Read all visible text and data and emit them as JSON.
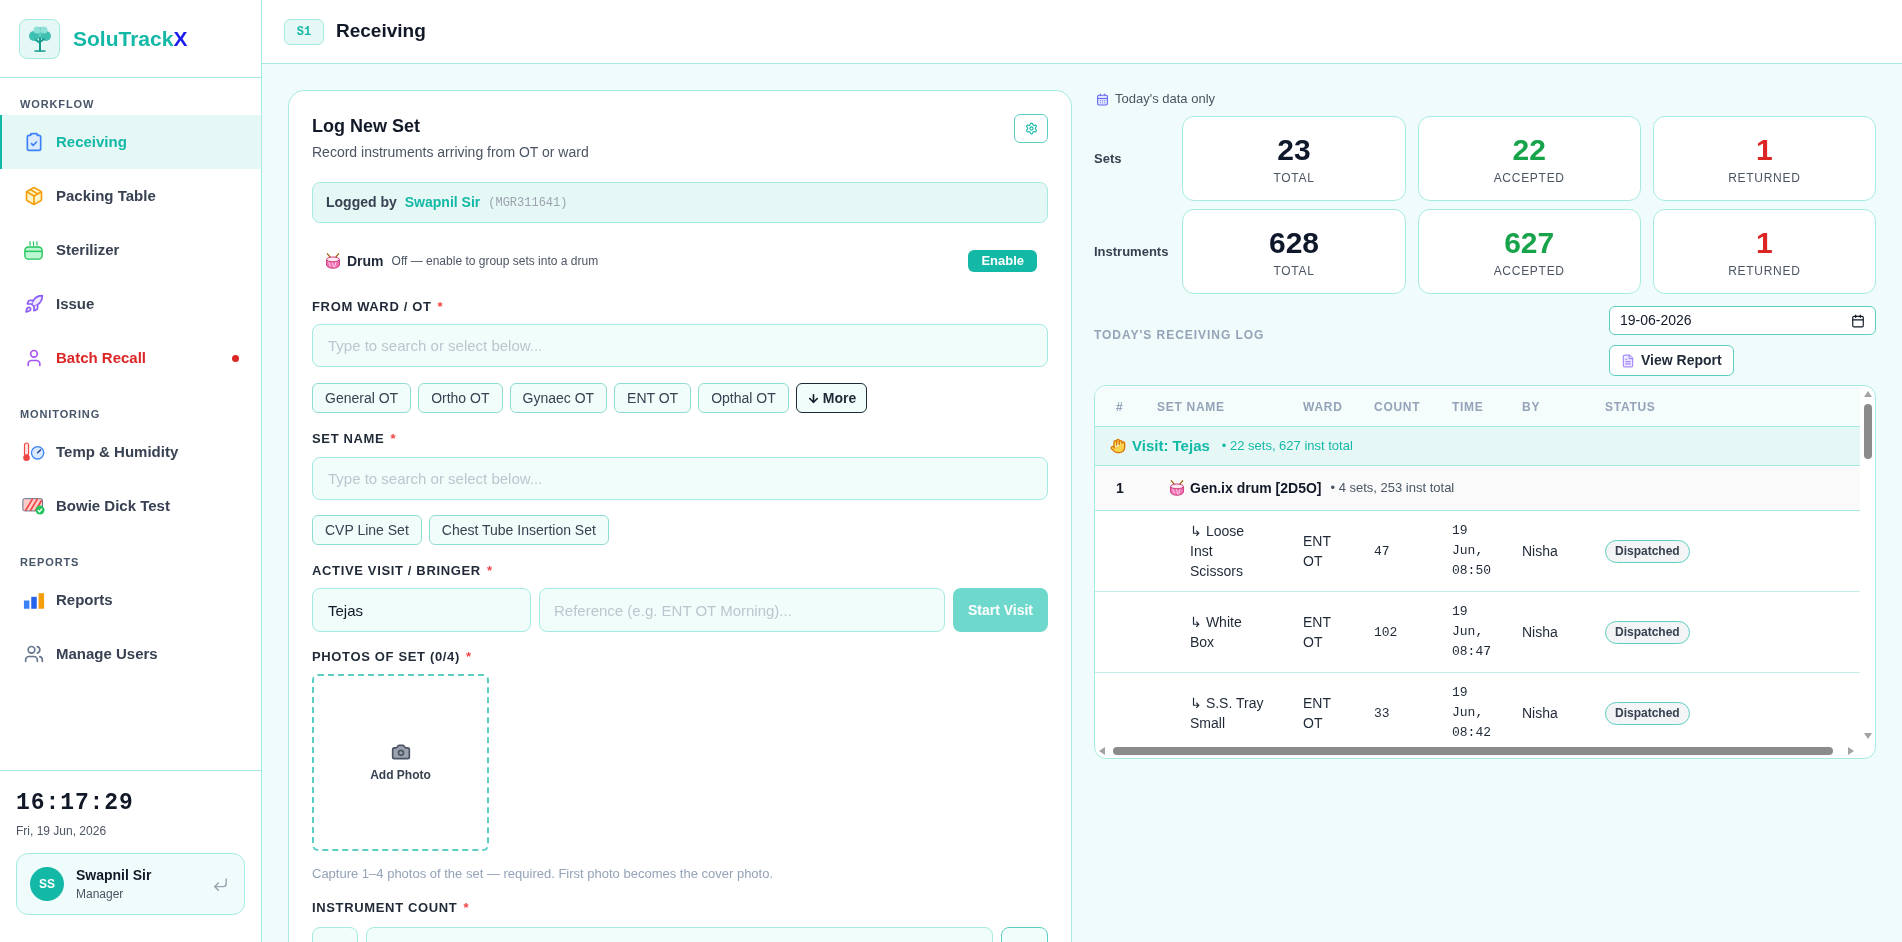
{
  "sidebar": {
    "brand": {
      "name": "SoluTrack",
      "accent": "X"
    },
    "sections": [
      {
        "title": "WORKFLOW",
        "items": [
          {
            "label": "Receiving",
            "selected": true,
            "alert": false
          },
          {
            "label": "Packing Table",
            "selected": false,
            "alert": false
          },
          {
            "label": "Sterilizer",
            "selected": false,
            "alert": false
          },
          {
            "label": "Issue",
            "selected": false,
            "alert": false
          },
          {
            "label": "Batch Recall",
            "selected": false,
            "alert": true
          }
        ]
      },
      {
        "title": "MONITORING",
        "items": [
          {
            "label": "Temp & Humidity",
            "selected": false,
            "alert": false
          },
          {
            "label": "Bowie Dick Test",
            "selected": false,
            "alert": false
          }
        ]
      },
      {
        "title": "REPORTS",
        "items": [
          {
            "label": "Reports",
            "selected": false,
            "alert": false
          },
          {
            "label": "Manage Users",
            "selected": false,
            "alert": false
          }
        ]
      }
    ],
    "clock": {
      "time": "16:17:29",
      "date": "Fri, 19 Jun, 2026"
    },
    "user": {
      "initials": "SS",
      "name": "Swapnil Sir",
      "role": "Manager"
    }
  },
  "header": {
    "badge": "S1",
    "title": "Receiving"
  },
  "form": {
    "title": "Log New Set",
    "subtitle": "Record instruments arriving from OT or ward",
    "logged_by": {
      "label": "Logged by",
      "name": "Swapnil Sir",
      "code": "(MGR311641)"
    },
    "drum": {
      "label": "Drum",
      "description": "Off — enable to group sets into a drum",
      "button": "Enable"
    },
    "ward": {
      "label": "FROM WARD / OT",
      "required_mark": "*",
      "placeholder": "Type to search or select below...",
      "chips": [
        "General OT",
        "Ortho OT",
        "Gynaec OT",
        "ENT OT",
        "Opthal OT"
      ],
      "more": "More"
    },
    "set_name": {
      "label": "SET NAME",
      "required_mark": "*",
      "placeholder": "Type to search or select below...",
      "chips": [
        "CVP Line Set",
        "Chest Tube Insertion Set"
      ]
    },
    "visit": {
      "label": "ACTIVE VISIT / BRINGER",
      "required_mark": "*",
      "bringer": {
        "value": "Tejas"
      },
      "reference": {
        "placeholder": "Reference (e.g. ENT OT Morning)..."
      },
      "button": {
        "label": "Start Visit",
        "disabled": true
      }
    },
    "photos": {
      "label": "PHOTOS OF SET (0/4)",
      "required_mark": "*",
      "add": "Add Photo",
      "hint": "Capture 1–4 photos of the set — required. First photo becomes the cover photo."
    },
    "instrument_count": {
      "label": "INSTRUMENT COUNT",
      "required_mark": "*"
    }
  },
  "summary": {
    "note": "Today's data only",
    "rows": [
      {
        "label": "Sets",
        "cells": [
          {
            "value": "23",
            "label": "TOTAL",
            "kind": "total"
          },
          {
            "value": "22",
            "label": "ACCEPTED",
            "kind": "accepted"
          },
          {
            "value": "1",
            "label": "RETURNED",
            "kind": "returned"
          }
        ]
      },
      {
        "label": "Instruments",
        "cells": [
          {
            "value": "628",
            "label": "TOTAL",
            "kind": "total"
          },
          {
            "value": "627",
            "label": "ACCEPTED",
            "kind": "accepted"
          },
          {
            "value": "1",
            "label": "RETURNED",
            "kind": "returned"
          }
        ]
      }
    ]
  },
  "log": {
    "title": "TODAY'S RECEIVING LOG",
    "date": {
      "value": "19-06-2026"
    },
    "report_button": "View Report",
    "table": {
      "columns": [
        "#",
        "SET NAME",
        "WARD",
        "COUNT",
        "TIME",
        "BY",
        "STATUS"
      ],
      "visit": {
        "label": "Visit: Tejas",
        "summary": "• 22 sets, 627 inst total"
      },
      "group": {
        "index": "1",
        "name": "Gen.ix drum [2D5O]",
        "summary": "• 4 sets, 253 inst total"
      },
      "rows": [
        {
          "name": "↳ Loose Inst Scissors",
          "ward": "ENT OT",
          "count": "47",
          "time": "19 Jun, 08:50",
          "by": "Nisha",
          "status": "Dispatched"
        },
        {
          "name": "↳ White Box",
          "ward": "ENT OT",
          "count": "102",
          "time": "19 Jun, 08:47",
          "by": "Nisha",
          "status": "Dispatched"
        },
        {
          "name": "↳ S.S. Tray Small",
          "ward": "ENT OT",
          "count": "33",
          "time": "19 Jun, 08:42",
          "by": "Nisha",
          "status": "Dispatched"
        }
      ]
    }
  }
}
